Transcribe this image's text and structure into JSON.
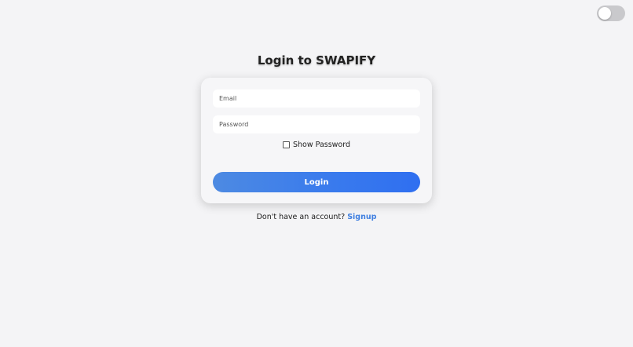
{
  "header": {
    "title": "Login to SWAPIFY"
  },
  "theme_toggle": {
    "state": "off",
    "track_color": "#c9c9cc",
    "knob_color": "#ffffff"
  },
  "form": {
    "email_placeholder": "Email",
    "email_value": "",
    "password_placeholder": "Password",
    "password_value": "",
    "show_password_label": "Show Password",
    "show_password_checked": false,
    "login_label": "Login"
  },
  "footer": {
    "prompt": "Don't have an account?",
    "signup_label": "Signup"
  },
  "colors": {
    "background": "#f4f4f6",
    "accent": "#3a7bed",
    "link": "#3f7fe0"
  }
}
